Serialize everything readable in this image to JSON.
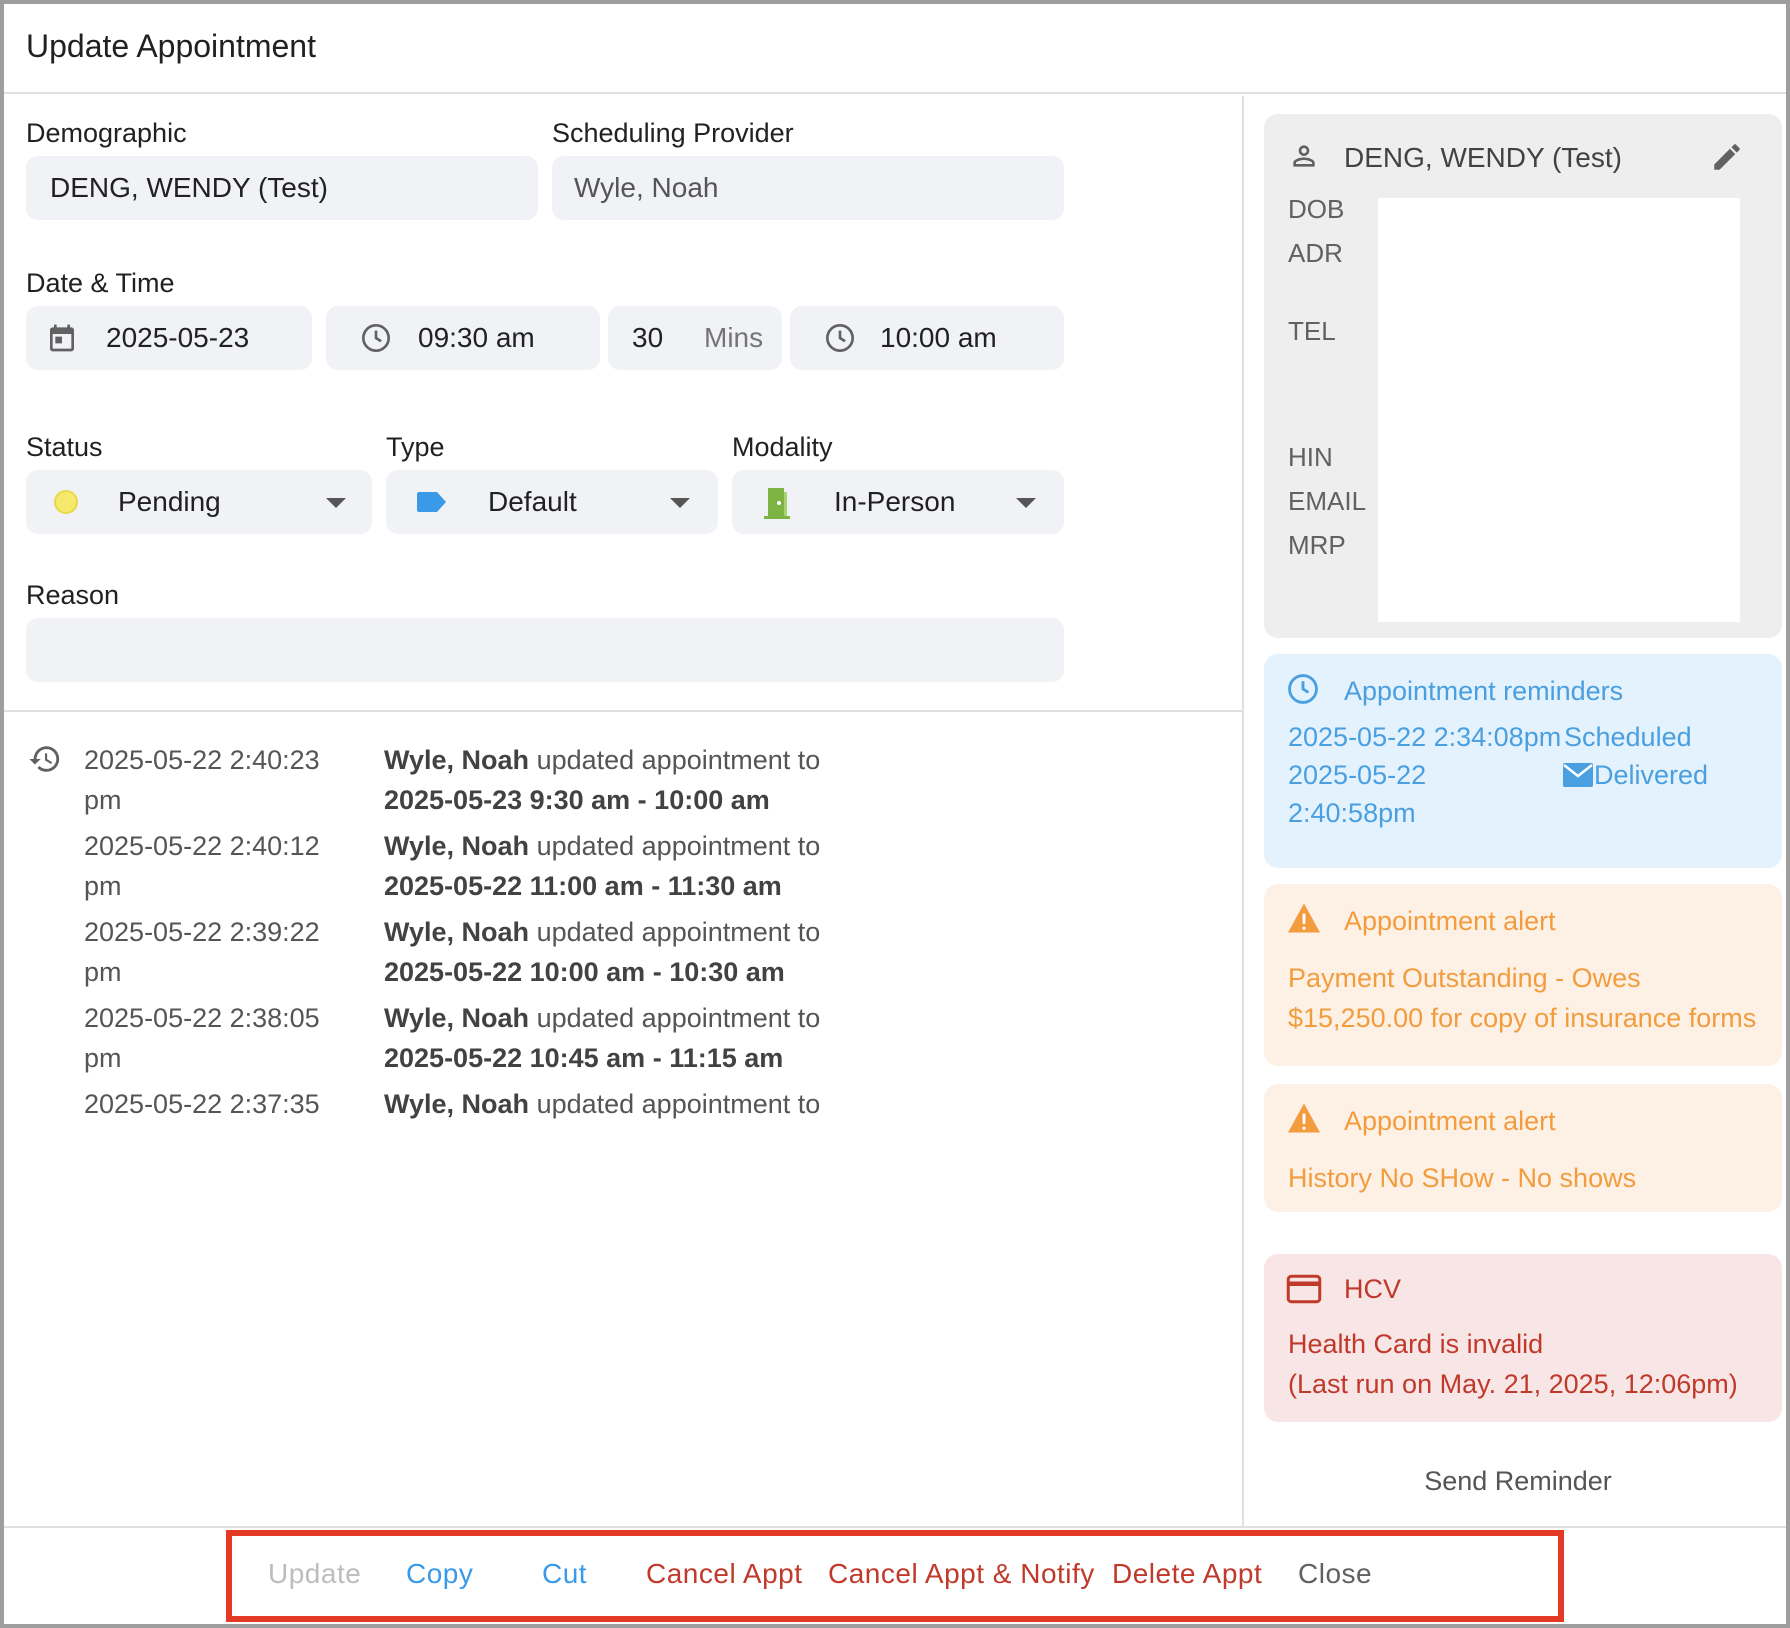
{
  "dialog": {
    "title": "Update Appointment"
  },
  "form": {
    "demographic": {
      "label": "Demographic",
      "value": "DENG, WENDY (Test)"
    },
    "provider": {
      "label": "Scheduling Provider",
      "value": "Wyle, Noah"
    },
    "datetime": {
      "label": "Date & Time",
      "date": "2025-05-23",
      "start": "09:30 am",
      "duration": "30",
      "duration_unit": "Mins",
      "end": "10:00 am"
    },
    "status": {
      "label": "Status",
      "value": "Pending",
      "color": "#f5e86b"
    },
    "type": {
      "label": "Type",
      "value": "Default",
      "color": "#3b9ae8"
    },
    "modality": {
      "label": "Modality",
      "value": "In-Person",
      "color": "#7cb342"
    },
    "reason": {
      "label": "Reason",
      "value": ""
    }
  },
  "history": [
    {
      "time": "2025-05-22 2:40:23 pm",
      "who": "Wyle, Noah",
      "action": "updated appointment to",
      "detail": "2025-05-23 9:30 am - 10:00 am"
    },
    {
      "time": "2025-05-22 2:40:12 pm",
      "who": "Wyle, Noah",
      "action": "updated appointment to",
      "detail": "2025-05-22 11:00 am - 11:30 am"
    },
    {
      "time": "2025-05-22 2:39:22 pm",
      "who": "Wyle, Noah",
      "action": "updated appointment to",
      "detail": "2025-05-22 10:00 am - 10:30 am"
    },
    {
      "time": "2025-05-22 2:38:05 pm",
      "who": "Wyle, Noah",
      "action": "updated appointment to",
      "detail": "2025-05-22 10:45 am - 11:15 am"
    },
    {
      "time": "2025-05-22 2:37:35",
      "who": "Wyle, Noah",
      "action": "updated appointment to",
      "detail": ""
    }
  ],
  "patient": {
    "name": "DENG, WENDY (Test)",
    "labels": {
      "dob": "DOB",
      "adr": "ADR",
      "tel": "TEL",
      "hin": "HIN",
      "email": "EMAIL",
      "mrp": "MRP"
    }
  },
  "reminders": {
    "title": "Appointment reminders",
    "items": [
      {
        "time": "2025-05-22 2:34:08pm",
        "status": "Scheduled"
      },
      {
        "time_line1": "2025-05-22",
        "time_line2": "2:40:58pm",
        "status": "Delivered"
      }
    ]
  },
  "alerts": [
    {
      "title": "Appointment alert",
      "body": "Payment Outstanding - Owes $15,250.00 for copy of insurance forms"
    },
    {
      "title": "Appointment alert",
      "body": "History No SHow - No shows"
    }
  ],
  "hcv": {
    "title": "HCV",
    "line1": "Health Card is invalid",
    "line2": "(Last run on May. 21, 2025, 12:06pm)"
  },
  "send_reminder": "Send Reminder",
  "actions": {
    "update": "Update",
    "copy": "Copy",
    "cut": "Cut",
    "cancel": "Cancel Appt",
    "cancel_notify": "Cancel Appt & Notify",
    "delete": "Delete Appt",
    "close": "Close"
  },
  "colors": {
    "primary": "#3b9ae8",
    "danger": "#c0392b",
    "warning": "#f39c3d",
    "disabled": "#bdbdbd",
    "highlight_border": "#e23a24"
  }
}
